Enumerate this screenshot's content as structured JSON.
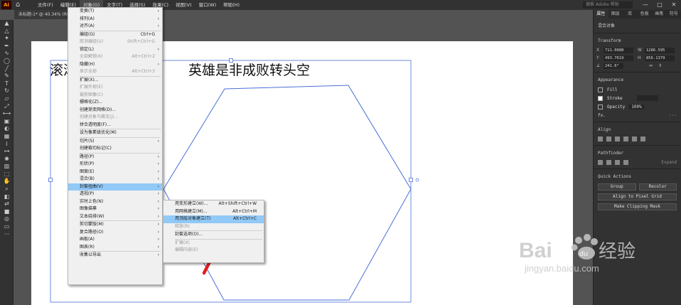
{
  "menubar": {
    "logo": "Ai",
    "items": [
      "文件(F)",
      "编辑(E)",
      "对象(O)",
      "文字(T)",
      "选择(S)",
      "效果(C)",
      "视图(V)",
      "窗口(W)",
      "帮助(H)"
    ],
    "search_placeholder": "搜索 Adobe 帮助"
  },
  "document": {
    "tab": "未标题-1* @ 40.34% (RG"
  },
  "canvas": {
    "text_left": "滚滚",
    "text_right": "英雄是非成败转头空"
  },
  "object_menu": [
    {
      "label": "变换(T)",
      "arrow": true
    },
    {
      "label": "排列(A)",
      "arrow": true
    },
    {
      "label": "对齐(A)",
      "arrow": true
    },
    {
      "sep": true
    },
    {
      "label": "编组(G)",
      "shortcut": "Ctrl+G"
    },
    {
      "label": "取消编组(U)",
      "shortcut": "Shift+Ctrl+G",
      "disabled": true
    },
    {
      "label": "锁定(L)",
      "arrow": true
    },
    {
      "label": "全部解锁(K)",
      "shortcut": "Alt+Ctrl+2",
      "disabled": true
    },
    {
      "label": "隐藏(H)",
      "arrow": true
    },
    {
      "label": "显示全部",
      "shortcut": "Alt+Ctrl+3",
      "disabled": true
    },
    {
      "sep": true
    },
    {
      "label": "扩展(X)..."
    },
    {
      "label": "扩展外观(E)",
      "disabled": true
    },
    {
      "label": "裁剪图像(C)",
      "disabled": true
    },
    {
      "label": "栅格化(Z)..."
    },
    {
      "label": "创建渐变网格(D)..."
    },
    {
      "label": "创建对象马赛克(J)...",
      "disabled": true
    },
    {
      "label": "拼合透明度(F)..."
    },
    {
      "sep": true
    },
    {
      "label": "设为像素级优化(M)"
    },
    {
      "sep": true
    },
    {
      "label": "切片(S)",
      "arrow": true
    },
    {
      "label": "创建裁切标记(C)"
    },
    {
      "sep": true
    },
    {
      "label": "路径(P)",
      "arrow": true
    },
    {
      "label": "形状(P)",
      "arrow": true
    },
    {
      "label": "图案(E)",
      "arrow": true
    },
    {
      "label": "混合(B)",
      "arrow": true
    },
    {
      "label": "封套扭曲(V)",
      "arrow": true,
      "highlight": true
    },
    {
      "label": "透视(P)",
      "arrow": true
    },
    {
      "label": "实时上色(N)",
      "arrow": true
    },
    {
      "label": "图像描摹",
      "arrow": true
    },
    {
      "label": "文本绕排(W)",
      "arrow": true
    },
    {
      "sep": true
    },
    {
      "label": "剪切蒙版(M)",
      "arrow": true
    },
    {
      "label": "复合路径(O)",
      "arrow": true
    },
    {
      "label": "画板(A)",
      "arrow": true
    },
    {
      "label": "图表(R)",
      "arrow": true
    },
    {
      "sep": true
    },
    {
      "label": "收集以导出",
      "arrow": true
    }
  ],
  "envelope_submenu": [
    {
      "label": "用变形建立(W)...",
      "shortcut": "Alt+Shift+Ctrl+W"
    },
    {
      "label": "用网格建立(M)...",
      "shortcut": "Alt+Ctrl+M"
    },
    {
      "label": "用顶层对象建立(T)",
      "shortcut": "Alt+Ctrl+C",
      "highlight": true
    },
    {
      "label": "释放(R)",
      "disabled": true
    },
    {
      "sep": true
    },
    {
      "label": "封套选项(O)..."
    },
    {
      "sep": true
    },
    {
      "label": "扩展(X)",
      "disabled": true
    },
    {
      "label": "编辑内容(E)",
      "disabled": true
    }
  ],
  "right_panel": {
    "tabs": [
      "属性",
      "图层",
      "库",
      "色板",
      "画笔",
      "符号"
    ],
    "subtitle": "混合对象",
    "transform": {
      "title": "Transform",
      "x": "711.0088",
      "y": "493.7619",
      "w": "1286.595",
      "h": "856.1379",
      "angle": "241.6°"
    },
    "appearance": {
      "title": "Appearance",
      "fill_label": "Fill",
      "stroke_label": "Stroke",
      "opacity_label": "Opacity",
      "opacity_value": "100%",
      "fx": "fx."
    },
    "align": {
      "title": "Align"
    },
    "pathfinder": {
      "title": "Pathfinder",
      "expand": "Expand"
    },
    "quick_actions": {
      "title": "Quick Actions",
      "group": "Group",
      "recolor": "Recolor",
      "align_pixel": "Align to Pixel Grid",
      "clipping": "Make Clipping Mask"
    }
  },
  "watermark": {
    "brand": "Bai",
    "brand2": "经验",
    "url": "jingyan.baidu.com"
  },
  "colors": {
    "highlight": "#91c9f7",
    "selection": "#4a6fd8",
    "arrow": "#e02020"
  }
}
